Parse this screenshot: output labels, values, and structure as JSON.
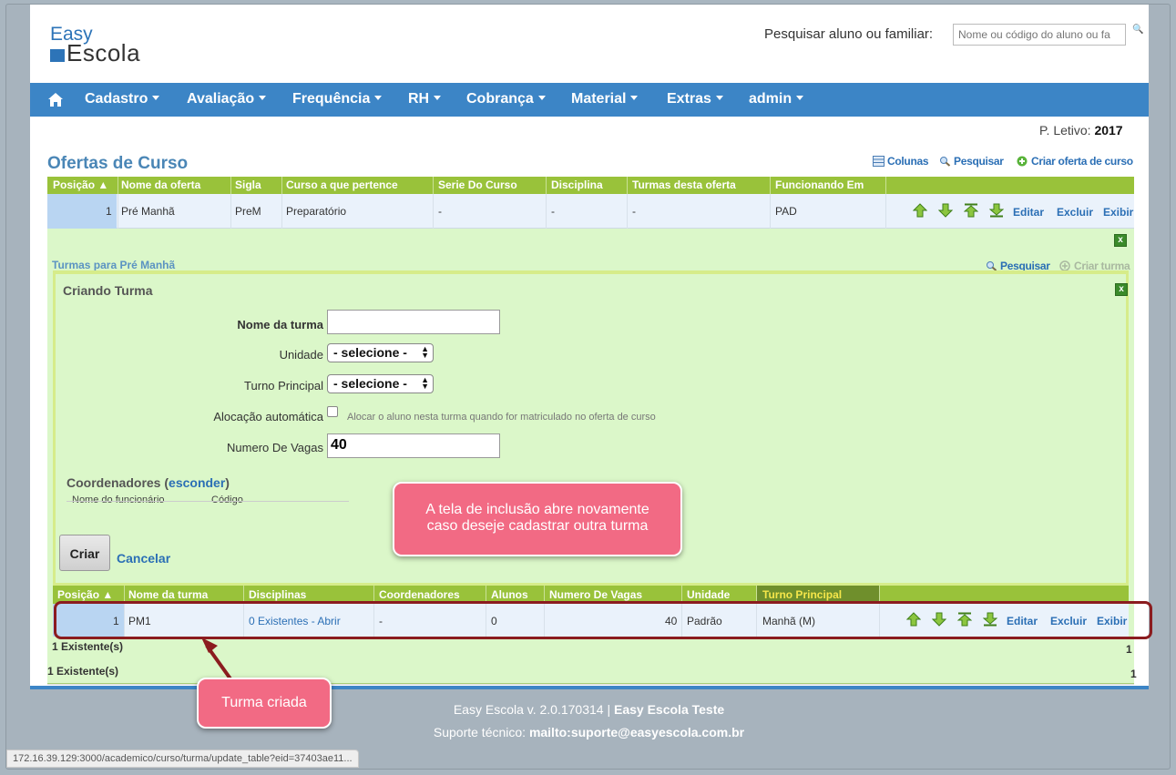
{
  "logo": {
    "line1": "Easy",
    "line2": "Escola"
  },
  "search": {
    "label": "Pesquisar aluno ou familiar:",
    "placeholder": "Nome ou código do aluno ou fa"
  },
  "nav": {
    "items": [
      {
        "label": "Cadastro"
      },
      {
        "label": "Avaliação"
      },
      {
        "label": "Frequência"
      },
      {
        "label": "RH"
      },
      {
        "label": "Cobrança"
      },
      {
        "label": "Material"
      },
      {
        "label": "Extras"
      },
      {
        "label": "admin"
      }
    ]
  },
  "periodo": {
    "label": "P. Letivo:",
    "value": "2017"
  },
  "page_title": "Ofertas de Curso",
  "toolbar": {
    "colunas": "Colunas",
    "pesquisar": "Pesquisar",
    "criar": "Criar oferta de curso"
  },
  "ofertas_table": {
    "headers": [
      "Posição",
      "Nome da oferta",
      "Sigla",
      "Curso a que pertence",
      "Serie Do Curso",
      "Disciplina",
      "Turmas desta oferta",
      "Funcionando Em"
    ],
    "row": {
      "posicao": "1",
      "nome": "Pré Manhã",
      "sigla": "PreM",
      "curso": "Preparatório",
      "serie": "-",
      "disciplina": "-",
      "turmas": "-",
      "funcionando": "PAD"
    },
    "actions": {
      "editar": "Editar",
      "excluir": "Excluir",
      "exibir": "Exibir"
    },
    "count": "1 Existente(s)",
    "page": "1"
  },
  "turmas": {
    "title": "Turmas para Pré Manhã",
    "pesquisar": "Pesquisar",
    "criar": "Criar turma",
    "close": "x"
  },
  "form": {
    "title": "Criando Turma",
    "nome_label": "Nome da turma",
    "nome_value": "",
    "unidade_label": "Unidade",
    "unidade_value": "- selecione -",
    "turno_label": "Turno Principal",
    "turno_value": "- selecione -",
    "alocacao_label": "Alocação automática",
    "alocacao_hint": "Alocar o aluno nesta turma quando for matriculado no oferta de curso",
    "vagas_label": "Numero De Vagas",
    "vagas_value": "40",
    "coord_title": "Coordenadores",
    "coord_toggle": "esconder",
    "coord_col1": "Nome do funcionário",
    "coord_col2": "Código",
    "criar": "Criar",
    "cancelar": "Cancelar"
  },
  "turmas_table": {
    "headers": [
      "Posição",
      "Nome da turma",
      "Disciplinas",
      "Coordenadores",
      "Alunos",
      "Numero De Vagas",
      "Unidade",
      "Turno Principal"
    ],
    "row": {
      "posicao": "1",
      "nome": "PM1",
      "disciplinas": "0 Existentes - Abrir",
      "coordenadores": "-",
      "alunos": "0",
      "vagas": "40",
      "unidade": "Padrão",
      "turno": "Manhã (M)"
    },
    "actions": {
      "editar": "Editar",
      "excluir": "Excluir",
      "exibir": "Exibir"
    },
    "count": "1 Existente(s)",
    "page": "1"
  },
  "footer": {
    "version": "Easy Escola v. 2.0.170314 |",
    "company": "Easy Escola Teste",
    "suporte_label": "Suporte técnico:",
    "suporte_email": "mailto:suporte@easyescola.com.br"
  },
  "statusbar": "172.16.39.129:3000/academico/curso/turma/update_table?eid=37403ae11...",
  "callouts": {
    "info_line1": "A tela de inclusão abre novamente",
    "info_line2": "caso deseje cadastrar outra turma",
    "turma_criada": "Turma criada"
  },
  "colors": {
    "navbar": "#3c85c6",
    "grid_header": "#99c23a",
    "panel": "#dbf7c9",
    "callout": "#f26a84",
    "highlight": "#8b1c1f"
  }
}
